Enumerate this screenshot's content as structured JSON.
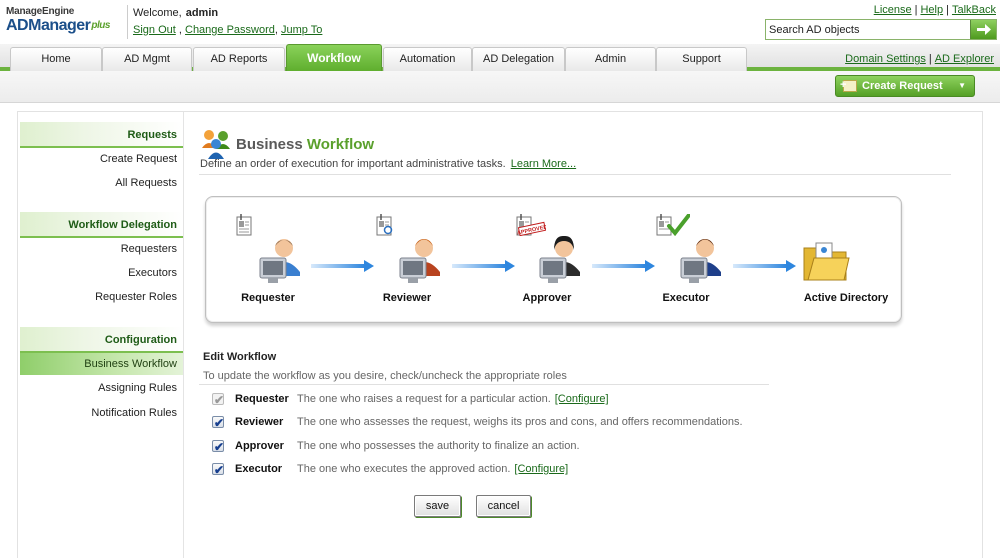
{
  "header": {
    "logo_line1": "ManageEngine",
    "logo_line2": "ADManager",
    "logo_plus": "plus",
    "welcome_text": "Welcome,",
    "username": "admin",
    "sign_out": "Sign Out",
    "sep_comma": ",",
    "change_password": "Change Password",
    "jump_to": "Jump To",
    "top_links": [
      "License",
      "Help",
      "TalkBack"
    ],
    "search_placeholder": "Search AD objects"
  },
  "nav": {
    "tabs": [
      "Home",
      "AD Mgmt",
      "AD Reports",
      "Workflow",
      "Automation",
      "AD Delegation",
      "Admin",
      "Support"
    ],
    "active_tab": "Workflow",
    "domain_settings": "Domain Settings",
    "ad_explorer": "AD Explorer"
  },
  "subbar": {
    "create_request": "Create Request"
  },
  "sidebar": {
    "sections": [
      {
        "title": "Requests",
        "items": [
          "Create Request",
          "All Requests"
        ]
      },
      {
        "title": "Workflow Delegation",
        "items": [
          "Requesters",
          "Executors",
          "Requester Roles"
        ]
      },
      {
        "title": "Configuration",
        "items": [
          "Business Workflow",
          "Assigning Rules",
          "Notification Rules"
        ]
      }
    ],
    "active_item": "Business Workflow"
  },
  "main": {
    "title_part1": "Business",
    "title_part2": "Workflow",
    "description": "Define an order of execution for important administrative tasks.",
    "learn_more": "Learn More...",
    "flow_stages": [
      "Requester",
      "Reviewer",
      "Approver",
      "Executor",
      "Active Directory"
    ],
    "approved_stamp": "APPROVED",
    "edit_workflow": {
      "title": "Edit Workflow",
      "description": "To update the workflow as you desire, check/uncheck the appropriate roles",
      "roles": [
        {
          "name": "Requester",
          "checked": true,
          "disabled": true,
          "description": "The one who raises a request for a particular action.",
          "link": "[Configure]"
        },
        {
          "name": "Reviewer",
          "checked": true,
          "disabled": false,
          "description": "The one who assesses the request, weighs its pros and cons, and offers recommendations.",
          "link": ""
        },
        {
          "name": "Approver",
          "checked": true,
          "disabled": false,
          "description": "The one who possesses the authority to finalize an action.",
          "link": ""
        },
        {
          "name": "Executor",
          "checked": true,
          "disabled": false,
          "description": "The one who executes the approved action.",
          "link": "[Configure]"
        }
      ]
    },
    "save_button": "save",
    "cancel_button": "cancel"
  },
  "colors": {
    "accent_green": "#6cb33f",
    "link_green": "#1a6a1a",
    "logo_blue": "#1b4f8a",
    "checkbox_blue": "#173f8f"
  }
}
